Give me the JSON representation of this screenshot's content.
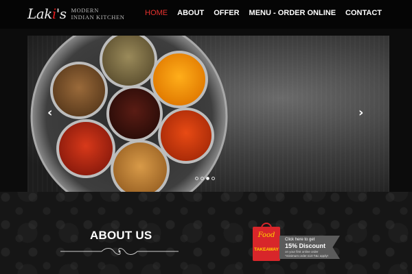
{
  "brand": {
    "script_name_a": "Lak",
    "script_name_b": "i",
    "script_name_c": "'s",
    "tagline_line1": "MODERN",
    "tagline_line2": "INDIAN KITCHEN"
  },
  "nav": {
    "items": [
      {
        "label": "HOME",
        "active": true
      },
      {
        "label": "ABOUT",
        "active": false
      },
      {
        "label": "OFFER",
        "active": false
      },
      {
        "label": "MENU - ORDER ONLINE",
        "active": false
      },
      {
        "label": "CONTACT",
        "active": false
      }
    ]
  },
  "slider": {
    "prev_icon": "chevron-left-icon",
    "next_icon": "chevron-right-icon",
    "prev_glyph": "‹",
    "next_glyph": "›",
    "dot_count": 4,
    "active_dot": 2
  },
  "about": {
    "title": "ABOUT US"
  },
  "promo": {
    "bag_line1": "Food",
    "bag_line2": "TAKEAWAY",
    "line1": "Click here to get",
    "line2": "15% Discount",
    "line3": "on your first online order",
    "line4": "*minimum order £10   T&c apply!"
  },
  "colors": {
    "accent": "#e8322e",
    "header_bg": "#050505",
    "bag": "#d8262a",
    "bag_text": "#ffd400"
  }
}
